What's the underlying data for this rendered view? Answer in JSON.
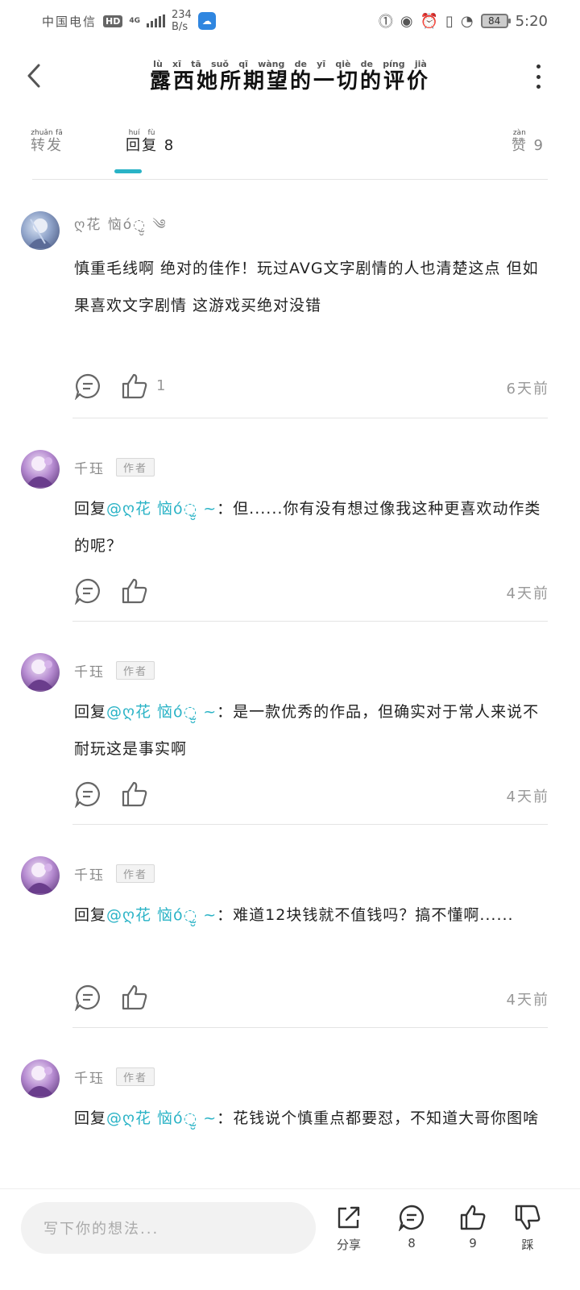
{
  "status_bar": {
    "carrier": "中国电信",
    "hd": "HD",
    "network": "4G",
    "speed_value": "234",
    "speed_unit": "B/s",
    "battery": "84",
    "time": "5:20"
  },
  "header": {
    "title": "露西她所期望的一切的评价",
    "title_pinyin": [
      "lù",
      "xī",
      "tā",
      "suǒ",
      "qī",
      "wàng",
      "de",
      "yī",
      "qiè",
      "de",
      "píng",
      "jià"
    ]
  },
  "tabs": {
    "forward": {
      "label": "转发",
      "pinyin": [
        "zhuǎn",
        "fā"
      ]
    },
    "reply": {
      "label": "回复",
      "pinyin": [
        "huí",
        "fù"
      ],
      "count": "8"
    },
    "like": {
      "label": "赞",
      "pinyin": [
        "zàn"
      ],
      "count": "9"
    }
  },
  "comments": [
    {
      "username": "ღ花 恼ό◌̫̮ ༄",
      "text": "慎重毛线啊 绝对的佳作！玩过AVG文字剧情的人也清楚这点 但如果喜欢文字剧情 这游戏买绝对没错",
      "likes": "1",
      "time": "6天前"
    },
    {
      "username": "千珏",
      "badge": "作者",
      "reply_label": "回复",
      "mention": "@ღ花 恼ό◌̫̮ ~",
      "text": "：但......你有没有想过像我这种更喜欢动作类的呢？",
      "time": "4天前"
    },
    {
      "username": "千珏",
      "badge": "作者",
      "reply_label": "回复",
      "mention": "@ღ花 恼ό◌̫̮ ~",
      "text": "：是一款优秀的作品，但确实对于常人来说不耐玩这是事实啊",
      "time": "4天前"
    },
    {
      "username": "千珏",
      "badge": "作者",
      "reply_label": "回复",
      "mention": "@ღ花 恼ό◌̫̮ ~",
      "text": "：难道12块钱就不值钱吗？搞不懂啊......",
      "time": "4天前"
    },
    {
      "username": "千珏",
      "badge": "作者",
      "reply_label": "回复",
      "mention": "@ღ花 恼ό◌̫̮ ~",
      "text": "：花钱说个慎重点都要怼，不知道大哥你图啥",
      "time": ""
    }
  ],
  "bottom_bar": {
    "compose_placeholder": "写下你的想法...",
    "share_label": "分享",
    "comment_count": "8",
    "like_count": "9",
    "dislike_label": "踩"
  },
  "colors": {
    "accent": "#2ab3c6",
    "mention": "#2ab3c6",
    "muted": "#999999"
  }
}
